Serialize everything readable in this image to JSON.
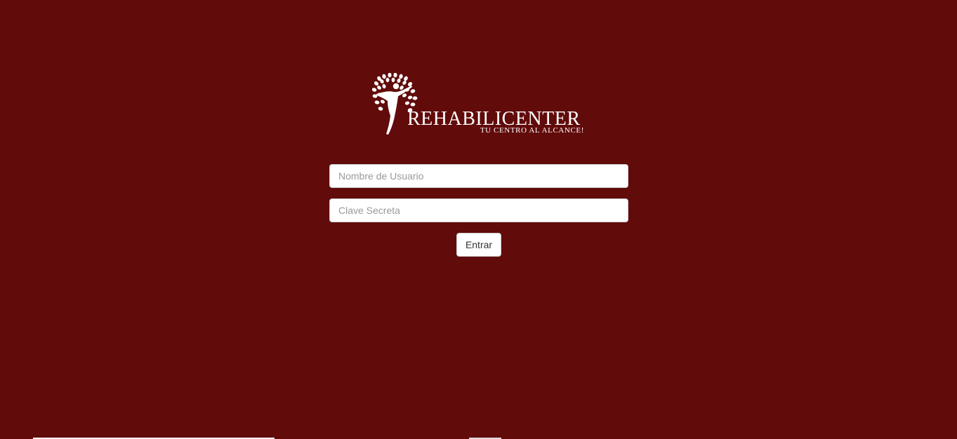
{
  "theme": {
    "background": "#610b0b",
    "field_background": "#ffffff",
    "field_border": "#cccccc",
    "placeholder_color": "#999999"
  },
  "brand": {
    "name": "REHABILICENTER",
    "tagline": "TU CENTRO AL ALCANCE!",
    "icon": "tree-person-icon"
  },
  "login": {
    "username_placeholder": "Nombre de Usuario",
    "password_placeholder": "Clave Secreta",
    "submit_label": "Entrar"
  }
}
